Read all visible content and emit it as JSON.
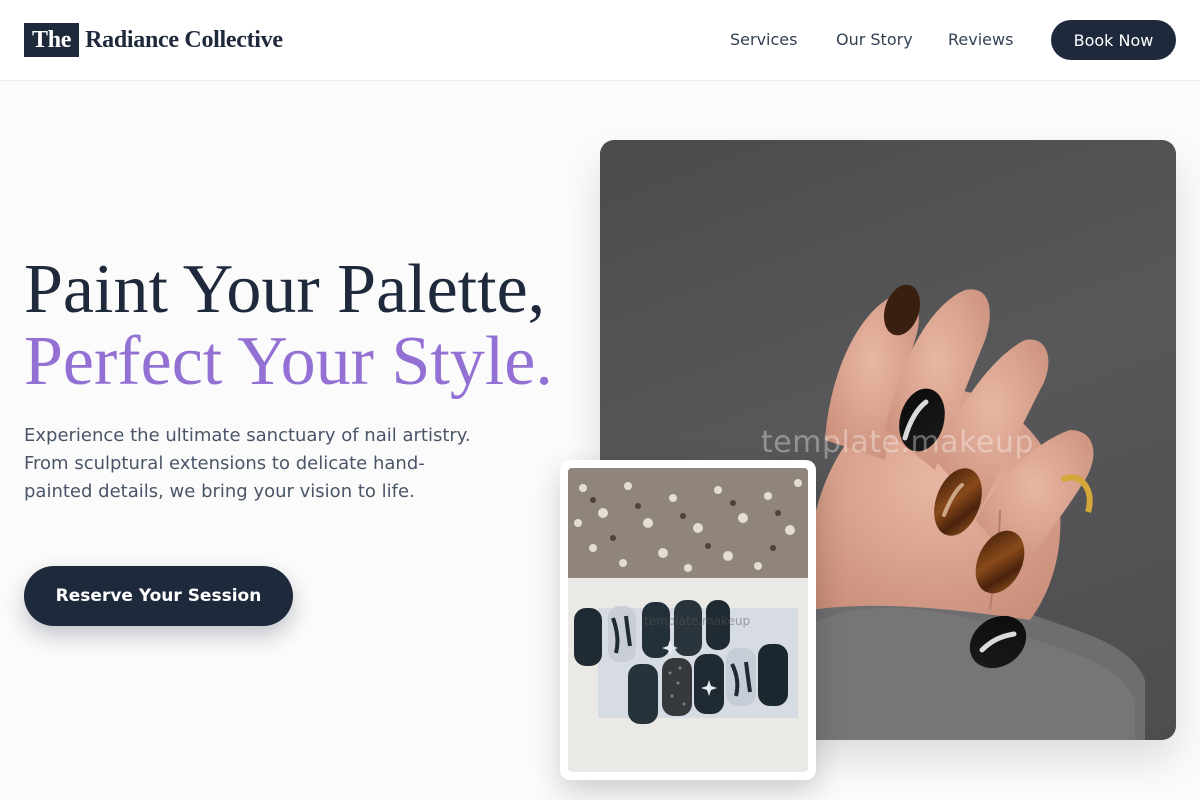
{
  "header": {
    "logo_prefix": "The",
    "logo_name": "Radiance Collective",
    "nav": [
      "Services",
      "Our Story",
      "Reviews"
    ],
    "cta_label": "Book Now"
  },
  "hero": {
    "headline_line1": "Paint Your Palette,",
    "headline_line2": "Perfect Your Style.",
    "subtitle": "Experience the ultimate sanctuary of nail artistry. From sculptural extensions to delicate hand-painted details, we bring your vision to life.",
    "cta_label": "Reserve Your Session"
  },
  "images": {
    "main_watermark": "template.makeup",
    "small_watermark": "template.makeup"
  },
  "colors": {
    "primary": "#1e293b",
    "accent": "#9370d3",
    "text_muted": "#4a5568",
    "background": "#fbfbfb"
  }
}
